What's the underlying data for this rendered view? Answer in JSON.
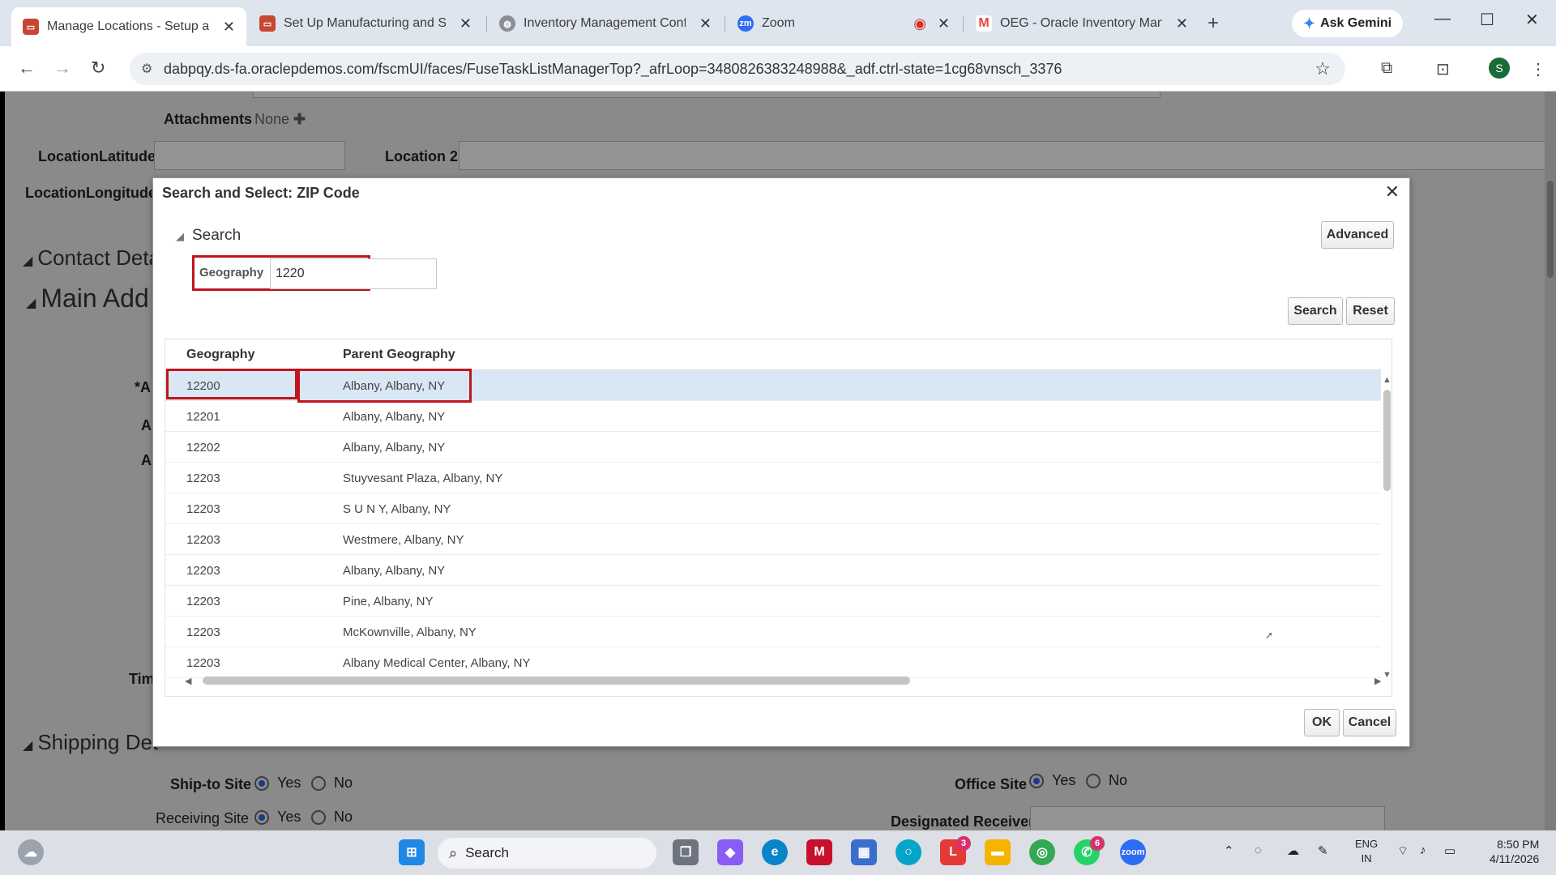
{
  "browser": {
    "tabs": [
      {
        "title": "Manage Locations - Setup and",
        "icon": "oracle-icon",
        "color": "#c74634",
        "active": true
      },
      {
        "title": "Set Up Manufacturing and Sup",
        "icon": "oracle-icon",
        "color": "#c74634",
        "active": false
      },
      {
        "title": "Inventory Management Config",
        "icon": "globe-icon",
        "color": "#8a8f96",
        "active": false
      },
      {
        "title": "Zoom",
        "icon": "zoom-icon",
        "color": "#2d6cf5",
        "active": false
      },
      {
        "title": "OEG - Oracle Inventory Manag",
        "icon": "gmail-icon",
        "color": "#ea4335",
        "active": false
      }
    ],
    "gemini_label": "Ask Gemini",
    "url": "dabpqy.ds-fa.oraclepdemos.com/fscmUI/faces/FuseTaskListManagerTop?_afrLoop=3480826383248988&_adf.ctrl-state=1cg68vnsch_3376",
    "profile_initial": "S"
  },
  "page": {
    "attachments_label": "Attachments",
    "attachments_value": "None",
    "latitude_label": "LocationLatitude",
    "longitude_label": "LocationLongitude",
    "location2_label": "Location 2",
    "contact_section": "Contact Deta",
    "main_address_section": "Main Add",
    "required_marker": "*A",
    "field_a1": "A",
    "field_a2": "A",
    "tim_label": "Tim",
    "shipping_section": "Shipping Det",
    "ship_to_label": "Ship-to Site",
    "receiving_label": "Receiving Site",
    "office_label": "Office Site",
    "designated_receiver_label": "Designated Receiver",
    "yes": "Yes",
    "no": "No"
  },
  "dialog": {
    "title": "Search and Select: ZIP Code",
    "search_header": "Search",
    "advanced_button": "Advanced",
    "geography_label": "Geography",
    "geography_value": "1220",
    "search_button": "Search",
    "reset_button": "Reset",
    "columns": [
      "Geography",
      "Parent Geography"
    ],
    "rows": [
      {
        "geography": "12200",
        "parent": "Albany, Albany, NY",
        "selected": true
      },
      {
        "geography": "12201",
        "parent": "Albany, Albany, NY"
      },
      {
        "geography": "12202",
        "parent": "Albany, Albany, NY"
      },
      {
        "geography": "12203",
        "parent": "Stuyvesant Plaza, Albany, NY"
      },
      {
        "geography": "12203",
        "parent": "S U N Y, Albany, NY"
      },
      {
        "geography": "12203",
        "parent": "Westmere, Albany, NY"
      },
      {
        "geography": "12203",
        "parent": "Albany, Albany, NY"
      },
      {
        "geography": "12203",
        "parent": "Pine, Albany, NY"
      },
      {
        "geography": "12203",
        "parent": "McKownville, Albany, NY"
      },
      {
        "geography": "12203",
        "parent": "Albany Medical Center, Albany, NY"
      }
    ],
    "ok_button": "OK",
    "cancel_button": "Cancel"
  },
  "taskbar": {
    "search_placeholder": "Search",
    "language": "ENG",
    "region": "IN",
    "time": "8:50 PM",
    "date": "4/11/2026",
    "badges": {
      "l_app": "3",
      "whatsapp": "6"
    }
  }
}
